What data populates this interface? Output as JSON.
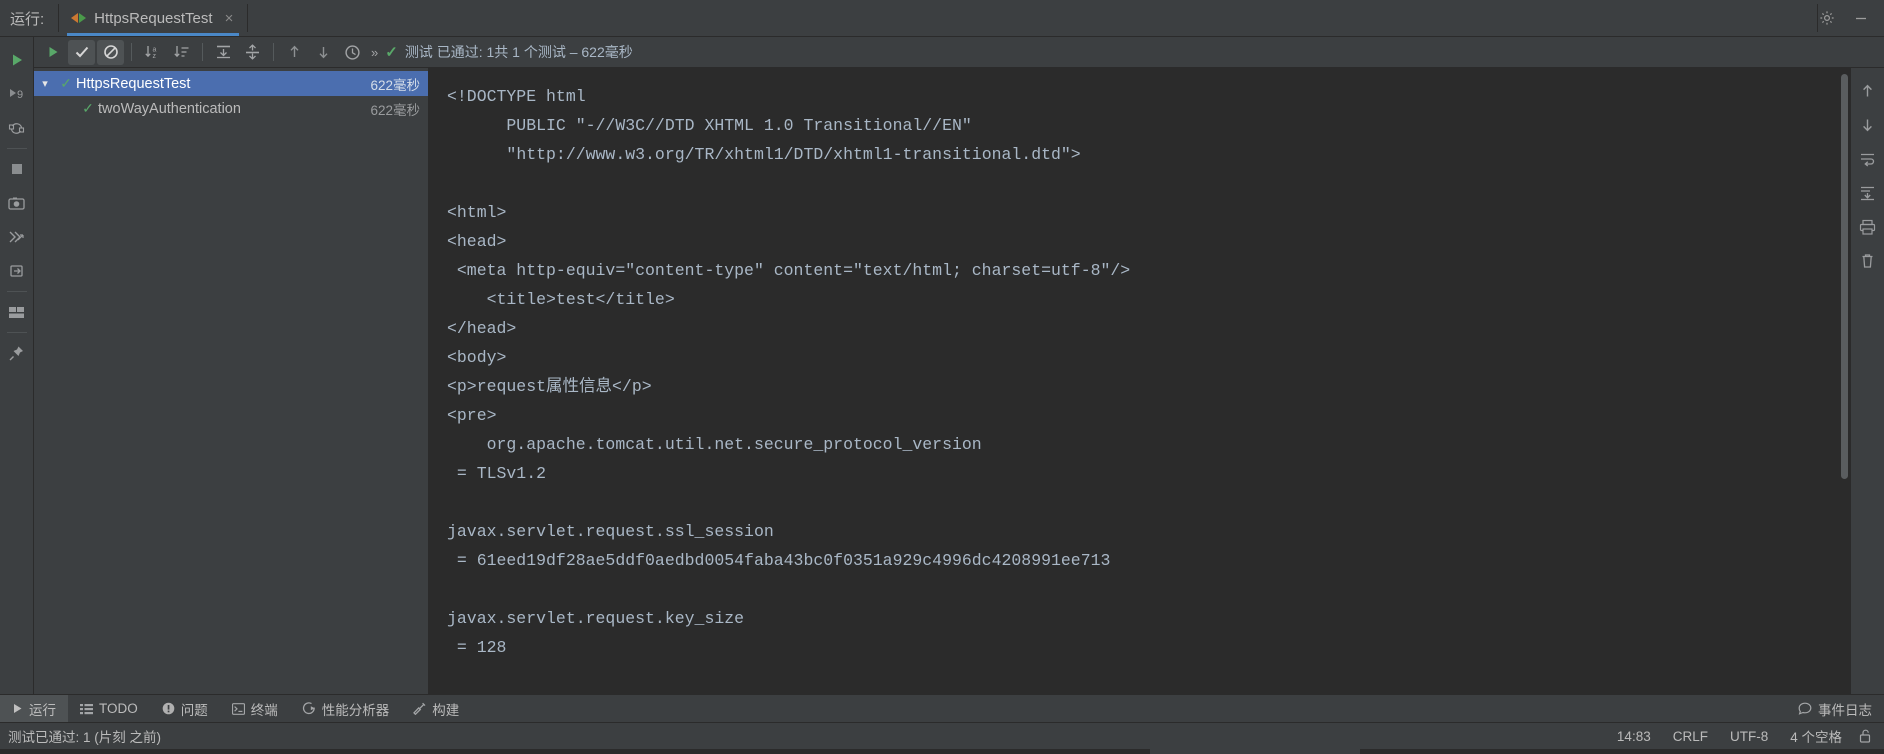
{
  "titlebar": {
    "run_label": "运行:",
    "tab_title": "HttpsRequestTest",
    "close_glyph": "×",
    "settings_icon": "gear-icon",
    "minimize_icon": "minimize-icon"
  },
  "left_gutter": {
    "items": [
      {
        "name": "run-icon",
        "title": "运行"
      },
      {
        "name": "rerun-failed-icon",
        "title": "重新运行"
      },
      {
        "name": "rerun-automatically-icon",
        "title": "自动重新运行"
      },
      {
        "name": "stop-icon",
        "title": "停止"
      },
      {
        "name": "snapshot-icon",
        "title": "快照"
      },
      {
        "name": "thread-dump-icon",
        "title": "线程转储"
      },
      {
        "name": "export-icon",
        "title": "导出"
      },
      {
        "name": "layout-icon",
        "title": "布局"
      },
      {
        "name": "pin-icon",
        "title": "固定"
      }
    ]
  },
  "run_toolbar": {
    "buttons": [
      {
        "name": "rerun-button",
        "label": "重新运行测试"
      },
      {
        "name": "show-passed-button",
        "label": "显示已通过"
      },
      {
        "name": "hide-passed-button",
        "label": "隐藏已通过"
      },
      {
        "name": "sort-alphabetically-button",
        "label": "按字母顺序排序"
      },
      {
        "name": "sort-by-duration-button",
        "label": "按持续时间排序"
      },
      {
        "name": "expand-all-button",
        "label": "全部展开"
      },
      {
        "name": "collapse-all-button",
        "label": "全部折叠"
      },
      {
        "name": "prev-failed-button",
        "label": "上一个失败的测试"
      },
      {
        "name": "next-failed-button",
        "label": "下一个失败的测试"
      },
      {
        "name": "test-history-button",
        "label": "测试历史记录"
      },
      {
        "name": "more-options-button",
        "label": "»"
      }
    ],
    "status_text": "测试 已通过: 1共 1 个测试 – 622毫秒"
  },
  "test_tree": {
    "rows": [
      {
        "name": "test-tree-root",
        "label": "HttpsRequestTest",
        "duration": "622毫秒",
        "selected": true,
        "expanded": true,
        "indent": false
      },
      {
        "name": "test-tree-item-twoWayAuthentication",
        "label": "twoWayAuthentication",
        "duration": "622毫秒",
        "selected": false,
        "expanded": false,
        "indent": true
      }
    ]
  },
  "console": {
    "lines": [
      {
        "text": "<!DOCTYPE html"
      },
      {
        "text": "      PUBLIC \"-//W3C//DTD XHTML 1.0 Transitional//EN\""
      },
      {
        "pre": "      \"",
        "link": "http://www.w3.org/TR/xhtml1/DTD/xhtml1-transitional.dtd",
        "post": "\">"
      },
      {
        "text": ""
      },
      {
        "text": "<html>"
      },
      {
        "text": "<head>"
      },
      {
        "text": " <meta http-equiv=\"content-type\" content=\"text/html; charset=utf-8\"/>"
      },
      {
        "text": "    <title>test</title>"
      },
      {
        "text": "</head>"
      },
      {
        "text": "<body>"
      },
      {
        "text": "<p>request属性信息</p>"
      },
      {
        "text": "<pre>"
      },
      {
        "text": "    org.apache.tomcat.util.net.secure_protocol_version"
      },
      {
        "text": " = TLSv1.2"
      },
      {
        "text": ""
      },
      {
        "text": "javax.servlet.request.ssl_session"
      },
      {
        "text": " = 61eed19df28ae5ddf0aedbd0054faba43bc0f0351a929c4996dc4208991ee713"
      },
      {
        "text": ""
      },
      {
        "text": "javax.servlet.request.key_size"
      },
      {
        "text": " = 128"
      }
    ]
  },
  "right_gutter": {
    "items": [
      {
        "name": "scroll-up-icon",
        "title": "上一次出现"
      },
      {
        "name": "scroll-down-icon",
        "title": "下一次出现"
      },
      {
        "name": "soft-wrap-icon",
        "title": "软换行"
      },
      {
        "name": "scroll-to-end-icon",
        "title": "滚动到末尾"
      },
      {
        "name": "print-icon",
        "title": "打印"
      },
      {
        "name": "trash-icon",
        "title": "清除全部"
      }
    ]
  },
  "toolwindow_bar": {
    "items": [
      {
        "name": "tool-run",
        "label": "运行",
        "icon": "play-icon",
        "active": true
      },
      {
        "name": "tool-todo",
        "label": "TODO",
        "icon": "list-icon",
        "active": false
      },
      {
        "name": "tool-problems",
        "label": "问题",
        "icon": "warning-icon",
        "active": false
      },
      {
        "name": "tool-terminal",
        "label": "终端",
        "icon": "terminal-icon",
        "active": false
      },
      {
        "name": "tool-profiler",
        "label": "性能分析器",
        "icon": "profiler-icon",
        "active": false
      },
      {
        "name": "tool-build",
        "label": "构建",
        "icon": "hammer-icon",
        "active": false
      }
    ],
    "event_log": {
      "label": "事件日志",
      "icon": "balloon-icon"
    }
  },
  "statusbar": {
    "message": "测试已通过: 1 (片刻 之前)",
    "caret_position": "14:83",
    "line_separator": "CRLF",
    "encoding": "UTF-8",
    "indent": "4 个空格",
    "lock_icon": "unlocked-icon"
  },
  "colors": {
    "accent_blue": "#4b6eaf",
    "tab_underline": "#4a88c7",
    "success_green": "#59a869",
    "panel_bg": "#3c3f41",
    "console_bg": "#2b2b2b",
    "text_primary": "#bbbbbb",
    "text_code": "#a9b7c6",
    "link_blue": "#5a87c7"
  }
}
